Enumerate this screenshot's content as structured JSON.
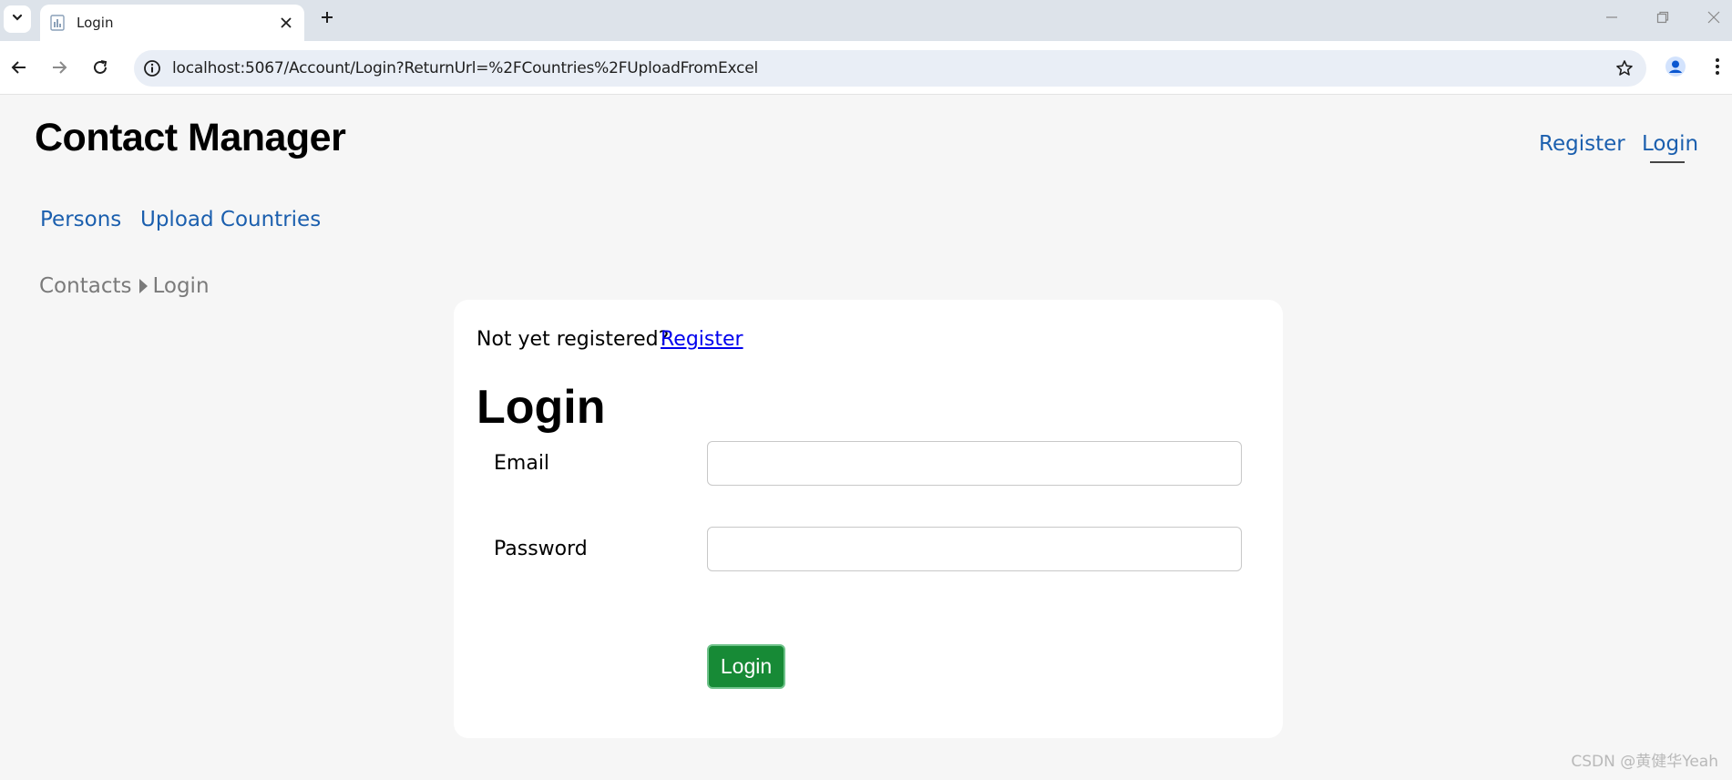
{
  "browser": {
    "tab_title": "Login",
    "url": "localhost:5067/Account/Login?ReturnUrl=%2FCountries%2FUploadFromExcel",
    "icons": [
      "tab-search-icon",
      "favicon-icon",
      "close-icon",
      "plus-icon",
      "minimize-icon",
      "restore-icon",
      "window-close-icon",
      "back-arrow-icon",
      "forward-arrow-icon",
      "reload-icon",
      "site-info-icon",
      "star-icon",
      "profile-icon",
      "kebab-menu-icon"
    ]
  },
  "header": {
    "app_title": "Contact Manager",
    "register_link": "Register",
    "login_link": "Login"
  },
  "nav": {
    "persons": "Persons",
    "upload_countries": "Upload Countries"
  },
  "breadcrumb": {
    "items": [
      "Contacts",
      "Login"
    ]
  },
  "login_card": {
    "prompt": "Not yet registered?",
    "register_link": "Register",
    "heading": "Login",
    "email_label": "Email",
    "email_value": "",
    "password_label": "Password",
    "password_value": "",
    "submit_label": "Login"
  },
  "colors": {
    "link": "#1b5fae",
    "button_green": "#178a36",
    "page_bg": "#f6f6f6"
  },
  "watermark": "CSDN @黄健华Yeah"
}
